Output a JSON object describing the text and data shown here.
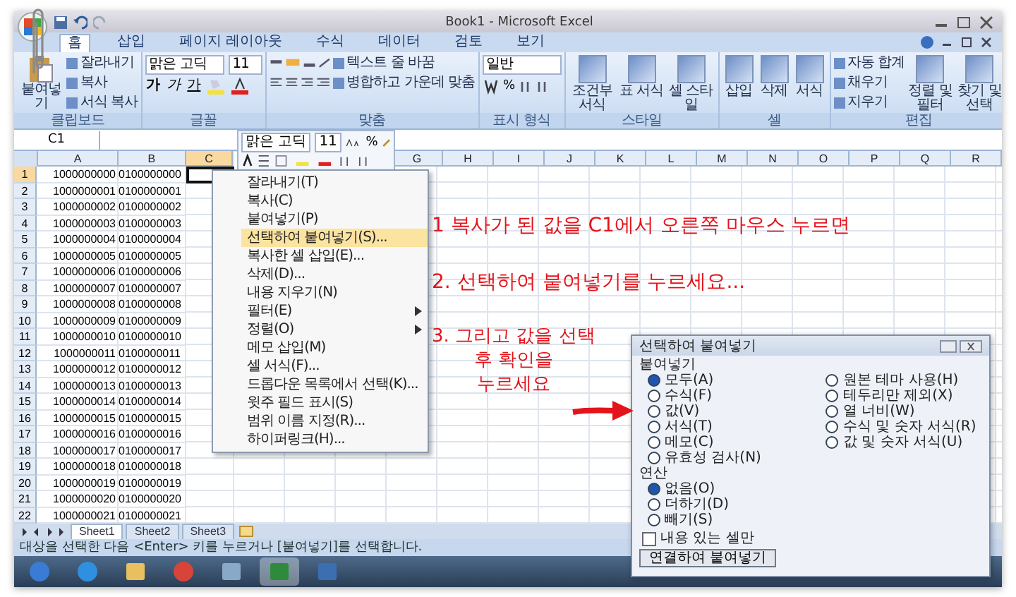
{
  "window": {
    "title": "Book1 - Microsoft Excel"
  },
  "ribbon_tabs": [
    {
      "label": "홈",
      "selected": true
    },
    {
      "label": "삽입",
      "selected": false
    },
    {
      "label": "페이지 레이아웃",
      "selected": false
    },
    {
      "label": "수식",
      "selected": false
    },
    {
      "label": "데이터",
      "selected": false
    },
    {
      "label": "검토",
      "selected": false
    },
    {
      "label": "보기",
      "selected": false
    }
  ],
  "ribbon": {
    "clipboard": {
      "label": "클립보드",
      "paste": "붙여넣기",
      "buttons": [
        "잘라내기",
        "복사",
        "서식 복사"
      ]
    },
    "font": {
      "label": "글꼴",
      "font": "맑은 고딕",
      "size": "11",
      "styles": [
        {
          "label": "가",
          "kind": "bold"
        },
        {
          "label": "가",
          "kind": "italic"
        },
        {
          "label": "가",
          "kind": "underline"
        }
      ]
    },
    "alignment": {
      "label": "맞춤",
      "buttons": [
        "텍스트 줄 바꿈",
        "병합하고 가운데 맞춤"
      ]
    },
    "number": {
      "label": "표시 형식",
      "format": "일반",
      "symbols": [
        "%"
      ]
    },
    "styles": {
      "label": "스타일",
      "buttons": [
        "조건부 서식",
        "표 서식",
        "셀 스타일"
      ]
    },
    "cells": {
      "label": "셀",
      "buttons": [
        "삽입",
        "삭제",
        "서식"
      ]
    },
    "editing": {
      "label": "편집",
      "small": [
        "자동 합계",
        "채우기",
        "지우기"
      ],
      "big": [
        "정렬 및 필터",
        "찾기 및 선택"
      ]
    }
  },
  "name_box": "C1",
  "columns": [
    {
      "label": "A",
      "selected": false
    },
    {
      "label": "B",
      "selected": false
    },
    {
      "label": "C",
      "selected": true
    },
    {
      "label": "G",
      "selected": false
    },
    {
      "label": "H",
      "selected": false
    },
    {
      "label": "I",
      "selected": false
    },
    {
      "label": "J",
      "selected": false
    },
    {
      "label": "K",
      "selected": false
    },
    {
      "label": "L",
      "selected": false
    },
    {
      "label": "M",
      "selected": false
    },
    {
      "label": "N",
      "selected": false
    },
    {
      "label": "O",
      "selected": false
    },
    {
      "label": "P",
      "selected": false
    },
    {
      "label": "Q",
      "selected": false
    },
    {
      "label": "R",
      "selected": false
    }
  ],
  "rows": [
    {
      "num": "1",
      "a": "1000000000",
      "b": "0100000000",
      "selected": true
    },
    {
      "num": "2",
      "a": "1000000001",
      "b": "0100000001",
      "selected": false
    },
    {
      "num": "3",
      "a": "1000000002",
      "b": "0100000002",
      "selected": false
    },
    {
      "num": "4",
      "a": "1000000003",
      "b": "0100000003",
      "selected": false
    },
    {
      "num": "5",
      "a": "1000000004",
      "b": "0100000004",
      "selected": false
    },
    {
      "num": "6",
      "a": "1000000005",
      "b": "0100000005",
      "selected": false
    },
    {
      "num": "7",
      "a": "1000000006",
      "b": "0100000006",
      "selected": false
    },
    {
      "num": "8",
      "a": "1000000007",
      "b": "0100000007",
      "selected": false
    },
    {
      "num": "9",
      "a": "1000000008",
      "b": "0100000008",
      "selected": false
    },
    {
      "num": "10",
      "a": "1000000009",
      "b": "0100000009",
      "selected": false
    },
    {
      "num": "11",
      "a": "1000000010",
      "b": "0100000010",
      "selected": false
    },
    {
      "num": "12",
      "a": "1000000011",
      "b": "0100000011",
      "selected": false
    },
    {
      "num": "13",
      "a": "1000000012",
      "b": "0100000012",
      "selected": false
    },
    {
      "num": "14",
      "a": "1000000013",
      "b": "0100000013",
      "selected": false
    },
    {
      "num": "15",
      "a": "1000000014",
      "b": "0100000014",
      "selected": false
    },
    {
      "num": "16",
      "a": "1000000015",
      "b": "0100000015",
      "selected": false
    },
    {
      "num": "17",
      "a": "1000000016",
      "b": "0100000016",
      "selected": false
    },
    {
      "num": "18",
      "a": "1000000017",
      "b": "0100000017",
      "selected": false
    },
    {
      "num": "19",
      "a": "1000000018",
      "b": "0100000018",
      "selected": false
    },
    {
      "num": "20",
      "a": "1000000019",
      "b": "0100000019",
      "selected": false
    },
    {
      "num": "21",
      "a": "1000000020",
      "b": "0100000020",
      "selected": false
    },
    {
      "num": "22",
      "a": "1000000021",
      "b": "0100000021",
      "selected": false
    }
  ],
  "mini_toolbar": {
    "font": "맑은 고딕",
    "size": "11",
    "symbols": [
      "%"
    ]
  },
  "context_menu": [
    {
      "label": "잘라내기(T)",
      "selected": false,
      "submenu": false
    },
    {
      "label": "복사(C)",
      "selected": false,
      "submenu": false
    },
    {
      "label": "붙여넣기(P)",
      "selected": false,
      "submenu": false
    },
    {
      "label": "선택하여 붙여넣기(S)...",
      "selected": true,
      "submenu": false
    },
    {
      "label": "복사한 셀 삽입(E)...",
      "selected": false,
      "submenu": false
    },
    {
      "label": "삭제(D)...",
      "selected": false,
      "submenu": false
    },
    {
      "label": "내용 지우기(N)",
      "selected": false,
      "submenu": false
    },
    {
      "label": "필터(E)",
      "selected": false,
      "submenu": true
    },
    {
      "label": "정렬(O)",
      "selected": false,
      "submenu": true
    },
    {
      "label": "메모 삽입(M)",
      "selected": false,
      "submenu": false
    },
    {
      "label": "셀 서식(F)...",
      "selected": false,
      "submenu": false
    },
    {
      "label": "드롭다운 목록에서 선택(K)...",
      "selected": false,
      "submenu": false
    },
    {
      "label": "윗주 필드 표시(S)",
      "selected": false,
      "submenu": false
    },
    {
      "label": "범위 이름 지정(R)...",
      "selected": false,
      "submenu": false
    },
    {
      "label": "하이퍼링크(H)...",
      "selected": false,
      "submenu": false
    }
  ],
  "annotations": [
    {
      "lines": [
        "1 복사가 된 값을 C1에서 오른쪽 마우스 누르면"
      ]
    },
    {
      "lines": [
        "2. 선택하여 붙여넣기를 누르세요..."
      ]
    },
    {
      "lines": [
        "3. 그리고 값을 선택",
        "후 확인을",
        "누르세요"
      ]
    }
  ],
  "sheet_tabs": [
    {
      "label": "Sheet1",
      "selected": true
    },
    {
      "label": "Sheet2",
      "selected": false
    },
    {
      "label": "Sheet3",
      "selected": false
    }
  ],
  "status_bar": "대상을 선택한 다음 <Enter> 키를 누르거나 [붙여넣기]를 선택합니다.",
  "taskbar": [
    {
      "kind": "start",
      "selected": false
    },
    {
      "kind": "browser",
      "selected": false
    },
    {
      "kind": "folder",
      "selected": false
    },
    {
      "kind": "chrome",
      "selected": false
    },
    {
      "kind": "app",
      "selected": false
    },
    {
      "kind": "excel",
      "selected": true
    },
    {
      "kind": "pen",
      "selected": false
    }
  ],
  "dialog": {
    "title": "선택하여 붙여넣기",
    "paste_label": "붙여넣기",
    "paste_left": [
      {
        "label": "모두(A)",
        "selected": true
      },
      {
        "label": "수식(F)",
        "selected": false
      },
      {
        "label": "값(V)",
        "selected": false
      },
      {
        "label": "서식(T)",
        "selected": false
      },
      {
        "label": "메모(C)",
        "selected": false
      },
      {
        "label": "유효성 검사(N)",
        "selected": false
      }
    ],
    "paste_right": [
      {
        "label": "원본 테마 사용(H)",
        "selected": false
      },
      {
        "label": "테두리만 제외(X)",
        "selected": false
      },
      {
        "label": "열 너비(W)",
        "selected": false
      },
      {
        "label": "수식 및 숫자 서식(R)",
        "selected": false
      },
      {
        "label": "값 및 숫자 서식(U)",
        "selected": false
      }
    ],
    "operation_label": "연산",
    "operations": [
      {
        "label": "없음(O)",
        "selected": true
      },
      {
        "label": "더하기(D)",
        "selected": false
      },
      {
        "label": "빼기(S)",
        "selected": false
      }
    ],
    "checkbox": {
      "label": "내용 있는 셀만",
      "checked": false
    },
    "button": "연결하여 붙여넣기"
  }
}
